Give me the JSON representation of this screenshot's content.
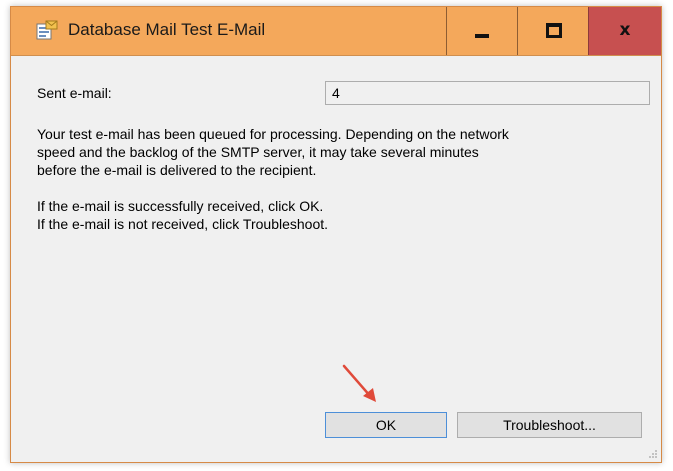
{
  "window": {
    "title": "Database Mail Test E-Mail"
  },
  "titlebar_buttons": {
    "minimize": "minimize",
    "maximize": "maximize",
    "close": "x"
  },
  "form": {
    "sent_label": "Sent e-mail:",
    "sent_value": "4"
  },
  "message": {
    "line1": "Your test e-mail has been queued for processing.  Depending on the network",
    "line2": "speed and the backlog of the SMTP server, it may take several minutes",
    "line3": "before the e-mail is delivered to the recipient.",
    "line4": "If the e-mail is successfully received, click OK.",
    "line5": "If the e-mail is not received, click Troubleshoot."
  },
  "buttons": {
    "ok_label": "OK",
    "troubleshoot_label": "Troubleshoot..."
  },
  "colors": {
    "titlebar": "#f4a85b",
    "close_button": "#c75050",
    "annotation_arrow": "#e04a3a"
  }
}
